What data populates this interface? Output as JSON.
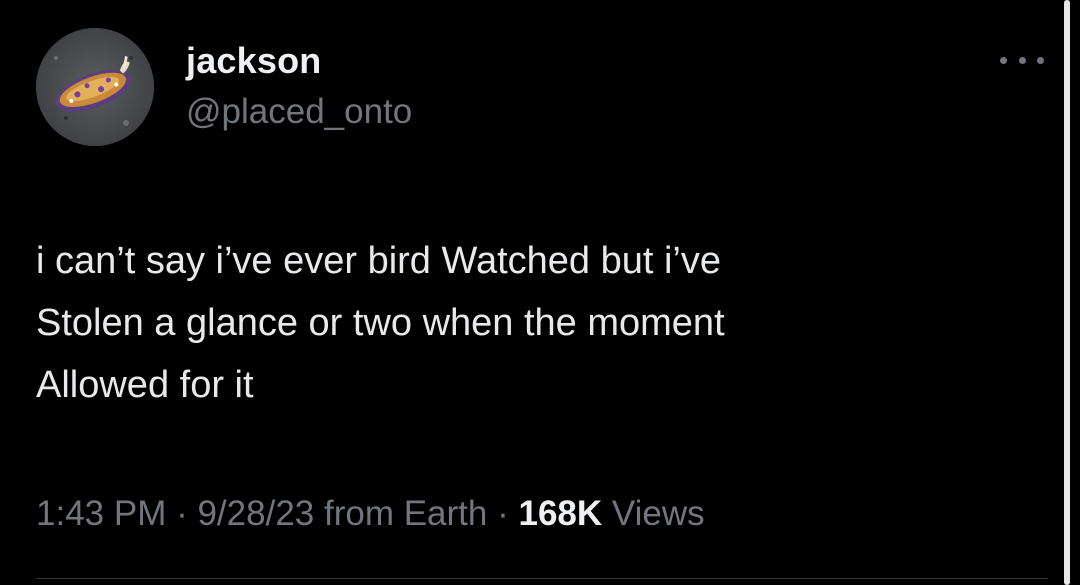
{
  "author": {
    "display_name": "jackson",
    "handle": "@placed_onto",
    "avatar_icon": "sea-slug-avatar"
  },
  "tweet": {
    "text": "i can’t say i’ve ever bird Watched but i’ve\nStolen a glance or two when the moment\nAllowed for it"
  },
  "meta": {
    "time": "1:43 PM",
    "separator": " · ",
    "date": "9/28/23",
    "source": "from Earth",
    "views_count": "168K",
    "views_label": "Views"
  },
  "icons": {
    "more": "more-options-icon"
  },
  "colors": {
    "background": "#000000",
    "primary_text": "#e7e9ea",
    "secondary_text": "#71767b"
  }
}
